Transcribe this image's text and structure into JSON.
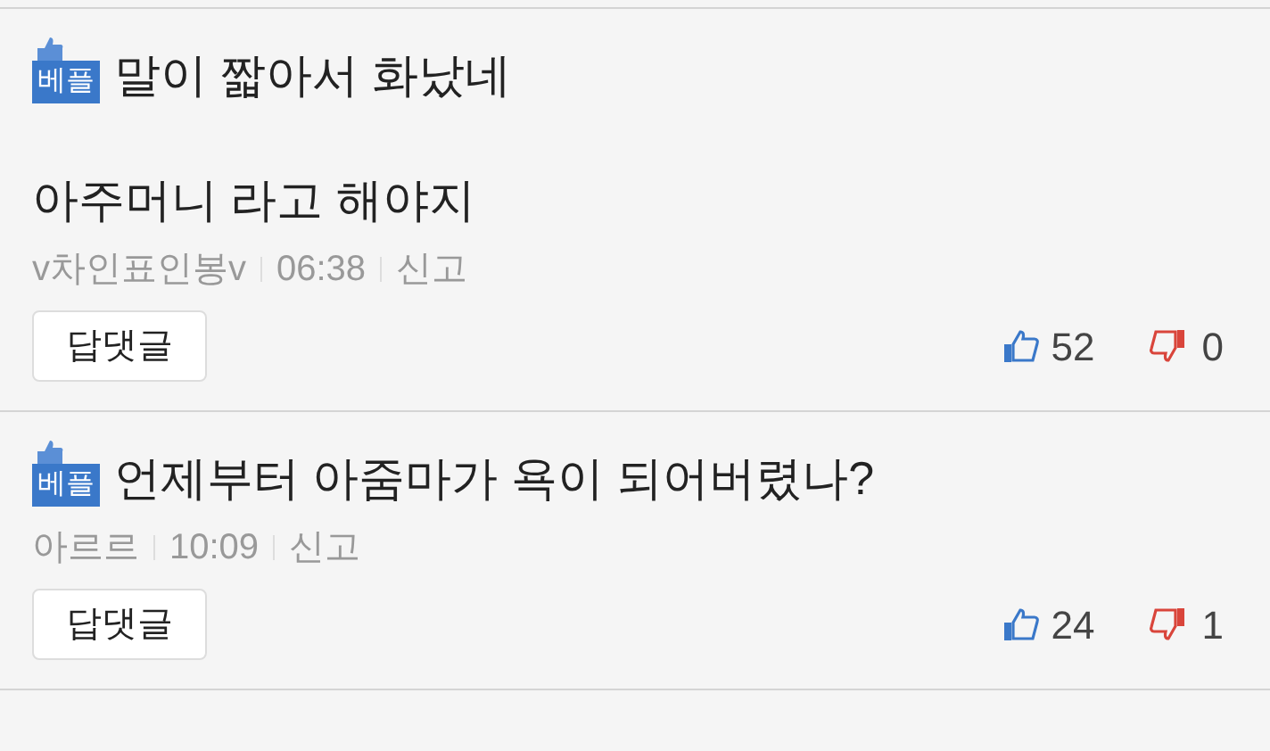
{
  "comments": [
    {
      "badge": "베플",
      "lines": [
        "말이 짧아서 화났네",
        "아주머니 라고 해야지"
      ],
      "author": "v차인표인봉v",
      "time": "06:38",
      "report": "신고",
      "reply_button": "답댓글",
      "likes": "52",
      "dislikes": "0"
    },
    {
      "badge": "베플",
      "lines": [
        "언제부터 아줌마가 욕이 되어버렸나?"
      ],
      "author": "아르르",
      "time": "10:09",
      "report": "신고",
      "reply_button": "답댓글",
      "likes": "24",
      "dislikes": "1"
    }
  ]
}
